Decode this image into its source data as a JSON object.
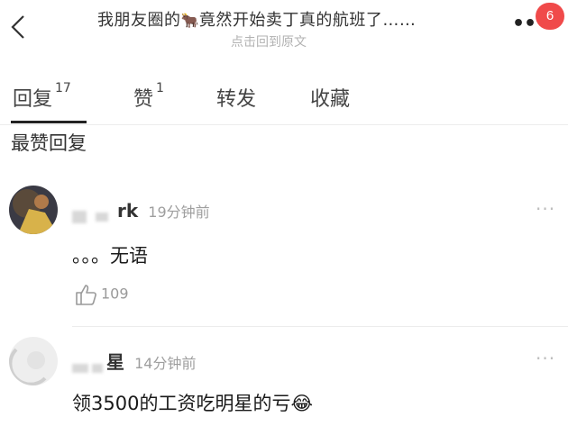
{
  "header": {
    "title_part1": "我朋友圈的",
    "title_emoji": "🐂",
    "title_part2": "竟然开始卖丁真的航班了……",
    "subtitle": "点击回到原文",
    "notification_count": "6"
  },
  "tabs": [
    {
      "label": "回复",
      "count": "17"
    },
    {
      "label": "赞",
      "count": "1"
    },
    {
      "label": "转发",
      "count": ""
    },
    {
      "label": "收藏",
      "count": ""
    }
  ],
  "section_title": "最赞回复",
  "comments": [
    {
      "username": "rk",
      "time": "19分钟前",
      "text": "。。。无语",
      "like_count": "109"
    },
    {
      "username": "星",
      "time": "14分钟前",
      "text": "领3500的工资吃明星的亏",
      "emoji": "😂"
    }
  ],
  "colors": {
    "badge": "#f04a4a",
    "muted": "#9e9e9e",
    "text": "#222222"
  }
}
